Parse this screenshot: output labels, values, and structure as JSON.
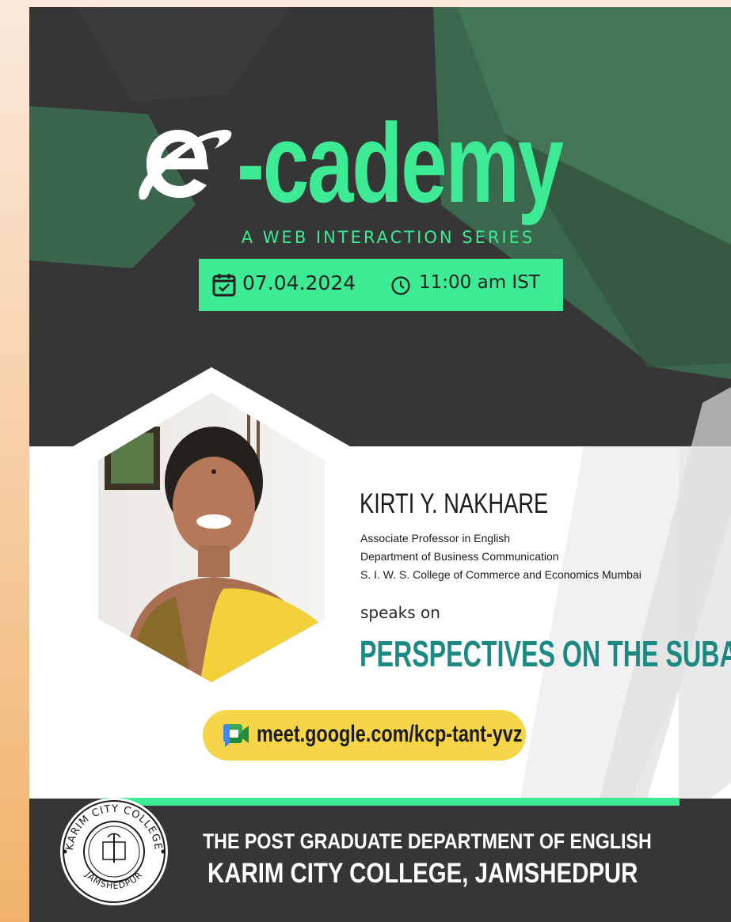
{
  "brand": {
    "logo_e": "e",
    "logo_rest": "-cademy",
    "subtitle": "A WEB INTERACTION SERIES"
  },
  "event": {
    "date": "07.04.2024",
    "time": "11:00 am IST"
  },
  "speaker": {
    "name": "KIRTI Y. NAKHARE",
    "lines": [
      "Associate Professor in English",
      "Department of Business Communication",
      "S. I. W. S. College of Commerce and Economics Mumbai"
    ],
    "speaks_on": "speaks on",
    "topic": "PERSPECTIVES ON THE SUBALTERN"
  },
  "meeting": {
    "link": "meet.google.com/kcp-tant-yvz"
  },
  "footer": {
    "department": "THE POST GRADUATE DEPARTMENT OF ENGLISH",
    "college": "KARIM CITY COLLEGE, JAMSHEDPUR"
  },
  "seal": {
    "top_text": "KARIM CITY COLLEGE",
    "bottom_text": "JAMSHEDPUR"
  },
  "icons": [
    "e-logo-icon",
    "calendar-icon",
    "clock-icon",
    "google-meet-icon",
    "college-seal-icon"
  ],
  "colors": {
    "accent_green": "#3deb94",
    "dark_bg": "#363636",
    "topic_teal": "#1c8a82",
    "pill_yellow": "#f7d548"
  }
}
